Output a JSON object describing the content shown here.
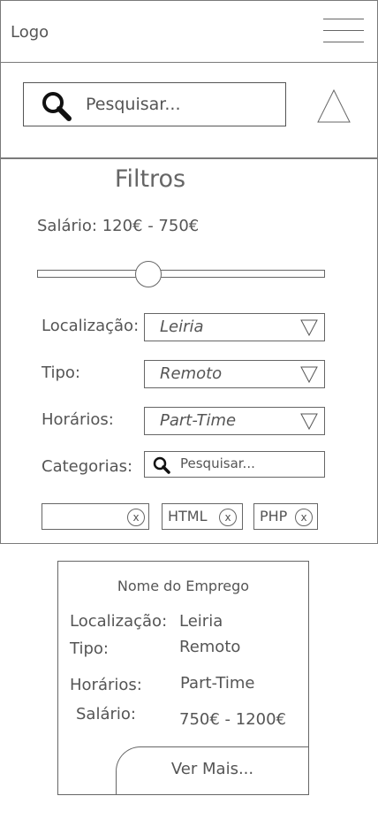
{
  "header": {
    "logo": "Logo"
  },
  "search": {
    "placeholder": "Pesquisar..."
  },
  "filters": {
    "title": "Filtros",
    "salary_label": "Salário: 120€ - 750€",
    "salary_slider_fraction": 0.385,
    "location": {
      "label": "Localização:",
      "value": "Leiria"
    },
    "type": {
      "label": "Tipo:",
      "value": "Remoto"
    },
    "hours": {
      "label": "Horários:",
      "value": "Part-Time"
    },
    "categories": {
      "label": "Categorias:",
      "search_placeholder": "Pesquisar...",
      "chips": [
        {
          "label": "",
          "remove": "x"
        },
        {
          "label": "HTML",
          "remove": "x"
        },
        {
          "label": "PHP",
          "remove": "x"
        }
      ]
    }
  },
  "job_card": {
    "title": "Nome do Emprego",
    "location_label": "Localização:",
    "location_value": "Leiria",
    "type_label": "Tipo:",
    "type_value": "Remoto",
    "hours_label": "Horários:",
    "hours_value": "Part-Time",
    "salary_label": "Salário:",
    "salary_value": "750€ - 1200€",
    "more_button": "Ver Mais..."
  },
  "icons": {
    "search": "search-icon",
    "menu": "hamburger-menu-icon",
    "collapse": "triangle-up-icon",
    "dropdown": "triangle-down-icon",
    "remove": "close-circle-icon"
  }
}
